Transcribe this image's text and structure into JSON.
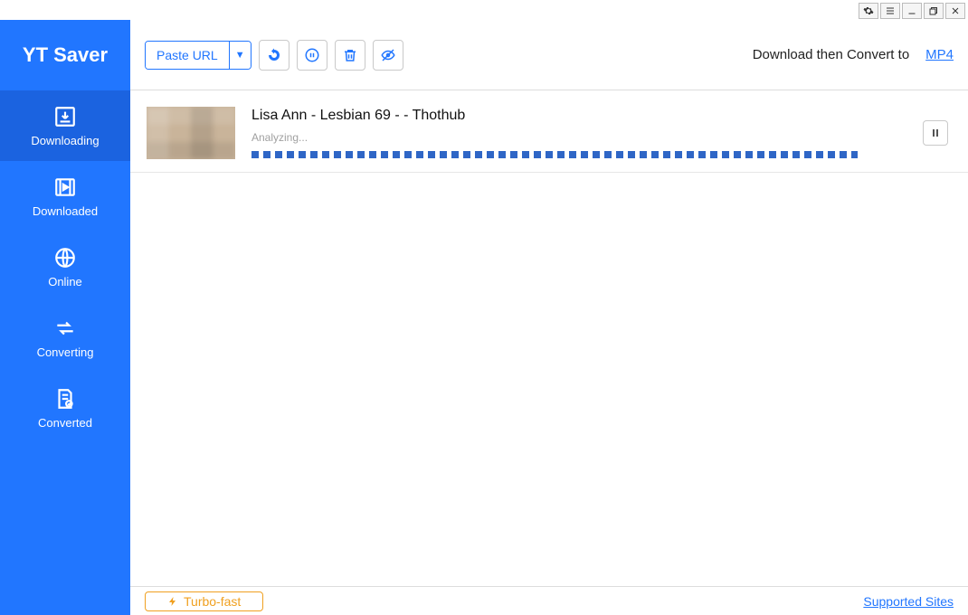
{
  "app": {
    "name": "YT Saver"
  },
  "window_buttons": {
    "settings": "gear",
    "menu": "menu",
    "minimize": "min",
    "maximize": "max",
    "close": "close"
  },
  "sidebar": {
    "items": [
      {
        "label": "Downloading",
        "icon": "download-icon",
        "active": true
      },
      {
        "label": "Downloaded",
        "icon": "film-icon",
        "active": false
      },
      {
        "label": "Online",
        "icon": "globe-icon",
        "active": false
      },
      {
        "label": "Converting",
        "icon": "convert-icon",
        "active": false
      },
      {
        "label": "Converted",
        "icon": "doc-check-icon",
        "active": false
      }
    ]
  },
  "toolbar": {
    "paste_label": "Paste URL",
    "convert_text": "Download then Convert to",
    "format": "MP4"
  },
  "downloads": [
    {
      "title": "Lisa Ann - Lesbian 69 - - Thothub",
      "status": "Analyzing..."
    }
  ],
  "footer": {
    "turbo_label": "Turbo-fast",
    "supported_label": "Supported Sites"
  }
}
